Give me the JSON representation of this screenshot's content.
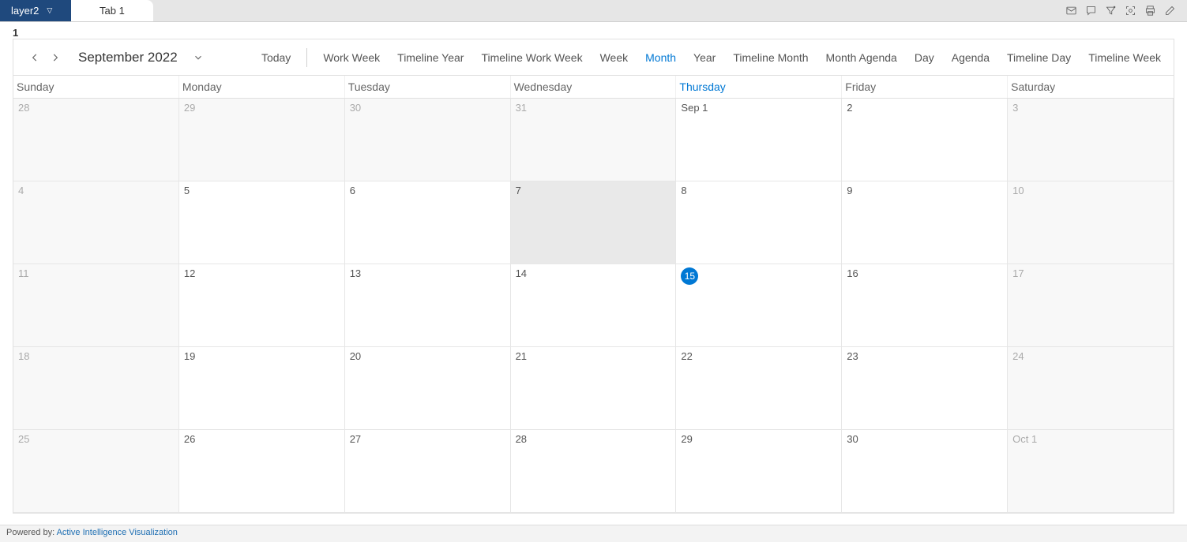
{
  "topbar": {
    "layer_label": "layer2",
    "tab_label": "Tab 1"
  },
  "page_number": "1",
  "calendar": {
    "title": "September 2022",
    "today_btn": "Today",
    "views": [
      {
        "label": "Work Week",
        "active": false
      },
      {
        "label": "Timeline Year",
        "active": false
      },
      {
        "label": "Timeline Work Week",
        "active": false
      },
      {
        "label": "Week",
        "active": false
      },
      {
        "label": "Month",
        "active": true
      },
      {
        "label": "Year",
        "active": false
      },
      {
        "label": "Timeline Month",
        "active": false
      },
      {
        "label": "Month Agenda",
        "active": false
      },
      {
        "label": "Day",
        "active": false
      },
      {
        "label": "Agenda",
        "active": false
      },
      {
        "label": "Timeline Day",
        "active": false
      },
      {
        "label": "Timeline Week",
        "active": false
      }
    ],
    "day_headers": [
      {
        "label": "Sunday",
        "active": false
      },
      {
        "label": "Monday",
        "active": false
      },
      {
        "label": "Tuesday",
        "active": false
      },
      {
        "label": "Wednesday",
        "active": false
      },
      {
        "label": "Thursday",
        "active": true
      },
      {
        "label": "Friday",
        "active": false
      },
      {
        "label": "Saturday",
        "active": false
      }
    ],
    "cells": [
      {
        "text": "28",
        "other": true
      },
      {
        "text": "29",
        "other": true
      },
      {
        "text": "30",
        "other": true
      },
      {
        "text": "31",
        "other": true
      },
      {
        "text": "Sep 1"
      },
      {
        "text": "2"
      },
      {
        "text": "3",
        "other": true
      },
      {
        "text": "4",
        "other": true
      },
      {
        "text": "5"
      },
      {
        "text": "6"
      },
      {
        "text": "7",
        "shade": true
      },
      {
        "text": "8"
      },
      {
        "text": "9"
      },
      {
        "text": "10",
        "other": true
      },
      {
        "text": "11",
        "other": true
      },
      {
        "text": "12"
      },
      {
        "text": "13"
      },
      {
        "text": "14"
      },
      {
        "text": "15",
        "today": true
      },
      {
        "text": "16"
      },
      {
        "text": "17",
        "other": true
      },
      {
        "text": "18",
        "other": true
      },
      {
        "text": "19"
      },
      {
        "text": "20"
      },
      {
        "text": "21"
      },
      {
        "text": "22"
      },
      {
        "text": "23"
      },
      {
        "text": "24",
        "other": true
      },
      {
        "text": "25",
        "other": true
      },
      {
        "text": "26"
      },
      {
        "text": "27"
      },
      {
        "text": "28"
      },
      {
        "text": "29"
      },
      {
        "text": "30"
      },
      {
        "text": "Oct 1",
        "other": true
      }
    ]
  },
  "footer": {
    "prefix": "Powered by: ",
    "link": "Active Intelligence Visualization"
  }
}
